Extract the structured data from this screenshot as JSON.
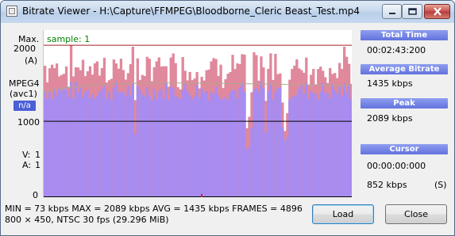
{
  "window": {
    "title": "Bitrate Viewer - H:\\Capture\\FFMPEG\\Bloodborne_Cleric Beast_Test.mp4"
  },
  "left_labels": {
    "max": "Max.",
    "max_value": "2000",
    "unit": "(A)",
    "codec": "MPEG4",
    "codec_sub": "(avc1)",
    "na_badge": "n/a",
    "mid_tick": "1000",
    "video_label": "V:",
    "video_value": "1",
    "audio_label": "A:",
    "audio_value": "1",
    "zero_tick": "0"
  },
  "plot": {
    "sample_label": "sample: 1",
    "max_line_value": 2000,
    "mid_line_value": 1000,
    "ylim": [
      0,
      2200
    ],
    "bar_color": "#a88cf0",
    "peak_color": "#e0889c",
    "average_color": "#b0a890",
    "max_line_color": "#a02020"
  },
  "panel": {
    "total_time_label": "Total Time",
    "total_time_value": "00:02:43:200",
    "avg_bitrate_label": "Average Bitrate",
    "avg_bitrate_value": "1435 kbps",
    "peak_label": "Peak",
    "peak_value": "2089 kbps",
    "cursor_label": "Cursor",
    "cursor_time_value": "00:00:00:000",
    "cursor_rate_value": "852 kbps",
    "cursor_rate_flag": "(S)"
  },
  "status": {
    "line1": "MIN = 73 kbps  MAX = 2089 kbps  AVG = 1435 kbps  FRAMES = 4896",
    "line2": "800 × 450, NTSC 30 fps (29.296 MiB)"
  },
  "buttons": {
    "load": "Load",
    "close": "Close"
  },
  "colors": {
    "panel_header": "#7080e6",
    "na_badge": "#4b5fd6"
  }
}
